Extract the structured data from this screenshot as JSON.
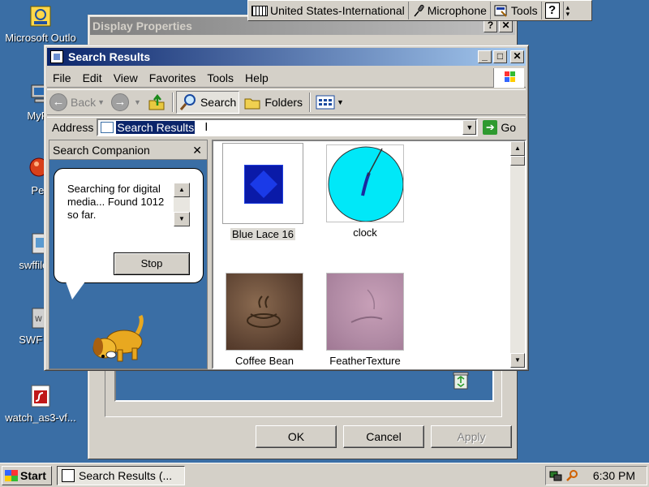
{
  "desktop": {
    "icons": [
      {
        "label": "Microsoft Outlo",
        "icon": "outlook-icon"
      },
      {
        "label": "MyPa",
        "icon": "my-computer-icon"
      },
      {
        "label": "Peg",
        "icon": "pegasus-icon"
      },
      {
        "label": "swffilepla",
        "icon": "swf-player-icon"
      },
      {
        "label": "SWF File",
        "icon": "swf-file-icon"
      },
      {
        "label": "watch_as3-vf...",
        "icon": "flash-file-icon"
      }
    ]
  },
  "language_bar": {
    "keyboard": "United States-International",
    "microphone": "Microphone",
    "tools": "Tools",
    "help": "?"
  },
  "display_properties": {
    "title": "Display Properties",
    "help_btn": "?",
    "close_btn": "✕",
    "ok": "OK",
    "cancel": "Cancel",
    "apply": "Apply"
  },
  "search_window": {
    "title": "Search Results",
    "controls": {
      "minimize": "_",
      "maximize": "□",
      "close": "✕"
    },
    "menu": [
      "File",
      "Edit",
      "View",
      "Favorites",
      "Tools",
      "Help"
    ],
    "toolbar": {
      "back": "Back",
      "search": "Search",
      "folders": "Folders"
    },
    "address": {
      "label": "Address",
      "value": "Search Results",
      "go": "Go"
    },
    "companion": {
      "title": "Search Companion",
      "close": "✕",
      "status": "Searching for digital media... Found 1012 so far.",
      "stop": "Stop"
    },
    "results": [
      {
        "label": "Blue Lace 16",
        "selected": true
      },
      {
        "label": "clock"
      },
      {
        "label": "Coffee Bean"
      },
      {
        "label": "FeatherTexture"
      }
    ]
  },
  "taskbar": {
    "start": "Start",
    "task": "Search Results (...",
    "clock": "6:30 PM"
  },
  "colors": {
    "desktop": "#3a6ea5",
    "title_active": "#0a246a",
    "face": "#d4d0c8"
  }
}
